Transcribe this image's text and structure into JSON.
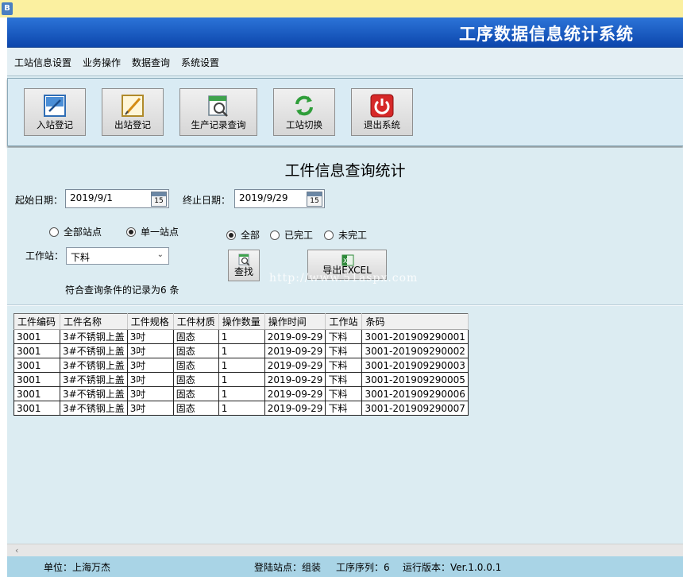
{
  "window": {
    "icon": "app-icon",
    "icon_glyph": "B"
  },
  "banner": {
    "title": "工序数据信息统计系统"
  },
  "menu": [
    "工站信息设置",
    "业务操作",
    "数据查询",
    "系统设置"
  ],
  "toolbar": [
    {
      "label": "入站登记",
      "icon": "check-in-icon"
    },
    {
      "label": "出站登记",
      "icon": "check-out-icon"
    },
    {
      "label": "生产记录查询",
      "icon": "record-search-icon"
    },
    {
      "label": "工站切换",
      "icon": "switch-icon"
    },
    {
      "label": "退出系统",
      "icon": "power-icon"
    }
  ],
  "query": {
    "heading": "工件信息查询统计",
    "start_label": "起始日期：",
    "start_value": "2019/9/1",
    "end_label": "终止日期：",
    "end_value": "2019/9/29",
    "calendar_day": "15",
    "station_scope": [
      {
        "label": "全部站点",
        "checked": false
      },
      {
        "label": "单一站点",
        "checked": true
      }
    ],
    "status_filter": [
      {
        "label": "全部",
        "checked": true
      },
      {
        "label": "已完工",
        "checked": false
      },
      {
        "label": "未完工",
        "checked": false
      }
    ],
    "station_label": "工作站：",
    "station_value": "下料",
    "search_label": "查找",
    "export_label": "导出EXCEL",
    "record_count_text": "符合查询条件的记录为6 条",
    "watermark": "http://www.51aspx.com"
  },
  "table": {
    "columns": [
      "工件编码",
      "工件名称",
      "工件规格",
      "工件材质",
      "操作数量",
      "操作时间",
      "工作站",
      "条码"
    ],
    "rows": [
      [
        "3001",
        "3#不锈钢上盖",
        "3吋",
        "固态",
        "1",
        "2019-09-29",
        "下料",
        "3001-201909290001"
      ],
      [
        "3001",
        "3#不锈钢上盖",
        "3吋",
        "固态",
        "1",
        "2019-09-29",
        "下料",
        "3001-201909290002"
      ],
      [
        "3001",
        "3#不锈钢上盖",
        "3吋",
        "固态",
        "1",
        "2019-09-29",
        "下料",
        "3001-201909290003"
      ],
      [
        "3001",
        "3#不锈钢上盖",
        "3吋",
        "固态",
        "1",
        "2019-09-29",
        "下料",
        "3001-201909290005"
      ],
      [
        "3001",
        "3#不锈钢上盖",
        "3吋",
        "固态",
        "1",
        "2019-09-29",
        "下料",
        "3001-201909290006"
      ],
      [
        "3001",
        "3#不锈钢上盖",
        "3吋",
        "固态",
        "1",
        "2019-09-29",
        "下料",
        "3001-201909290007"
      ]
    ]
  },
  "status": {
    "unit": "单位：上海万杰",
    "login_station": "登陆站点：组装",
    "sequence": "工序序列：6",
    "version": "运行版本：Ver.1.0.0.1"
  }
}
